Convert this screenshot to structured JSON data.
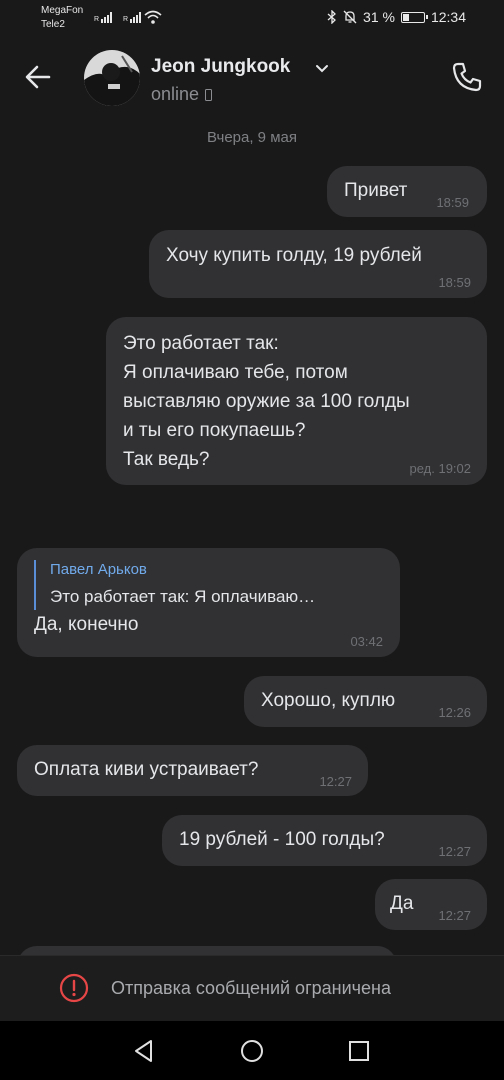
{
  "status_bar": {
    "carrier1": "MegaFon",
    "carrier2": "Tele2",
    "battery": "31 %",
    "time": "12:34"
  },
  "header": {
    "name": "Jeon Jungkook",
    "status": "online",
    "back_icon": "arrow-left-icon",
    "call_icon": "phone-icon"
  },
  "chat": {
    "date_separator": "Вчера, 9 мая",
    "messages": [
      {
        "side": "out",
        "text": "Привет",
        "time": "18:59"
      },
      {
        "side": "out",
        "text": "Хочу купить голду, 19 рублей",
        "time": "18:59"
      },
      {
        "side": "out",
        "text": "Это работает так:\nЯ оплачиваю тебе, потом\nвыставляю оружие за 100 голды\nи ты его покупаешь?\nТак ведь?",
        "time": "ред. 19:02"
      },
      {
        "side": "in",
        "reply_author": "Павел Арьков",
        "reply_text": "Это работает так: Я оплачиваю…",
        "text": "Да, конечно",
        "time": "03:42"
      },
      {
        "side": "out",
        "text": "Хорошо, куплю",
        "time": "12:26"
      },
      {
        "side": "in",
        "text": "Оплата киви устраивает?",
        "time": "12:27"
      },
      {
        "side": "out",
        "text": "19 рублей - 100 голды?",
        "time": "12:27"
      },
      {
        "side": "out",
        "text": "Да",
        "time": "12:27"
      }
    ]
  },
  "footer": {
    "restriction_text": "Отправка сообщений ограничена",
    "restriction_icon": "alert-circle-icon"
  },
  "colors": {
    "background": "#19191a",
    "bubble": "#313133",
    "accent": "#71aaeb",
    "alert": "#e64646"
  }
}
